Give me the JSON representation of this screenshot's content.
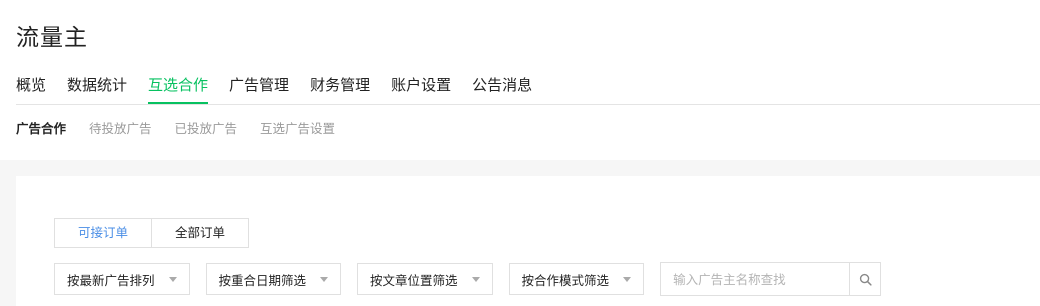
{
  "app": {
    "title": "流量主"
  },
  "main_nav": [
    {
      "label": "概览",
      "active": false
    },
    {
      "label": "数据统计",
      "active": false
    },
    {
      "label": "互选合作",
      "active": true
    },
    {
      "label": "广告管理",
      "active": false
    },
    {
      "label": "财务管理",
      "active": false
    },
    {
      "label": "账户设置",
      "active": false
    },
    {
      "label": "公告消息",
      "active": false
    }
  ],
  "sub_nav": [
    {
      "label": "广告合作",
      "active": true
    },
    {
      "label": "待投放广告",
      "active": false
    },
    {
      "label": "已投放广告",
      "active": false
    },
    {
      "label": "互选广告设置",
      "active": false
    }
  ],
  "order_toggle": [
    {
      "label": "可接订单",
      "active": true
    },
    {
      "label": "全部订单",
      "active": false
    }
  ],
  "filters": [
    {
      "label": "按最新广告排列"
    },
    {
      "label": "按重合日期筛选"
    },
    {
      "label": "按文章位置筛选"
    },
    {
      "label": "按合作模式筛选"
    }
  ],
  "search": {
    "placeholder": "输入广告主名称查找",
    "value": ""
  },
  "icons": {
    "search": "search-icon",
    "dropdown": "caret-down-icon"
  },
  "colors": {
    "accent": "#07c160",
    "link": "#4a8ee6",
    "page_bg": "#f6f6f6"
  }
}
